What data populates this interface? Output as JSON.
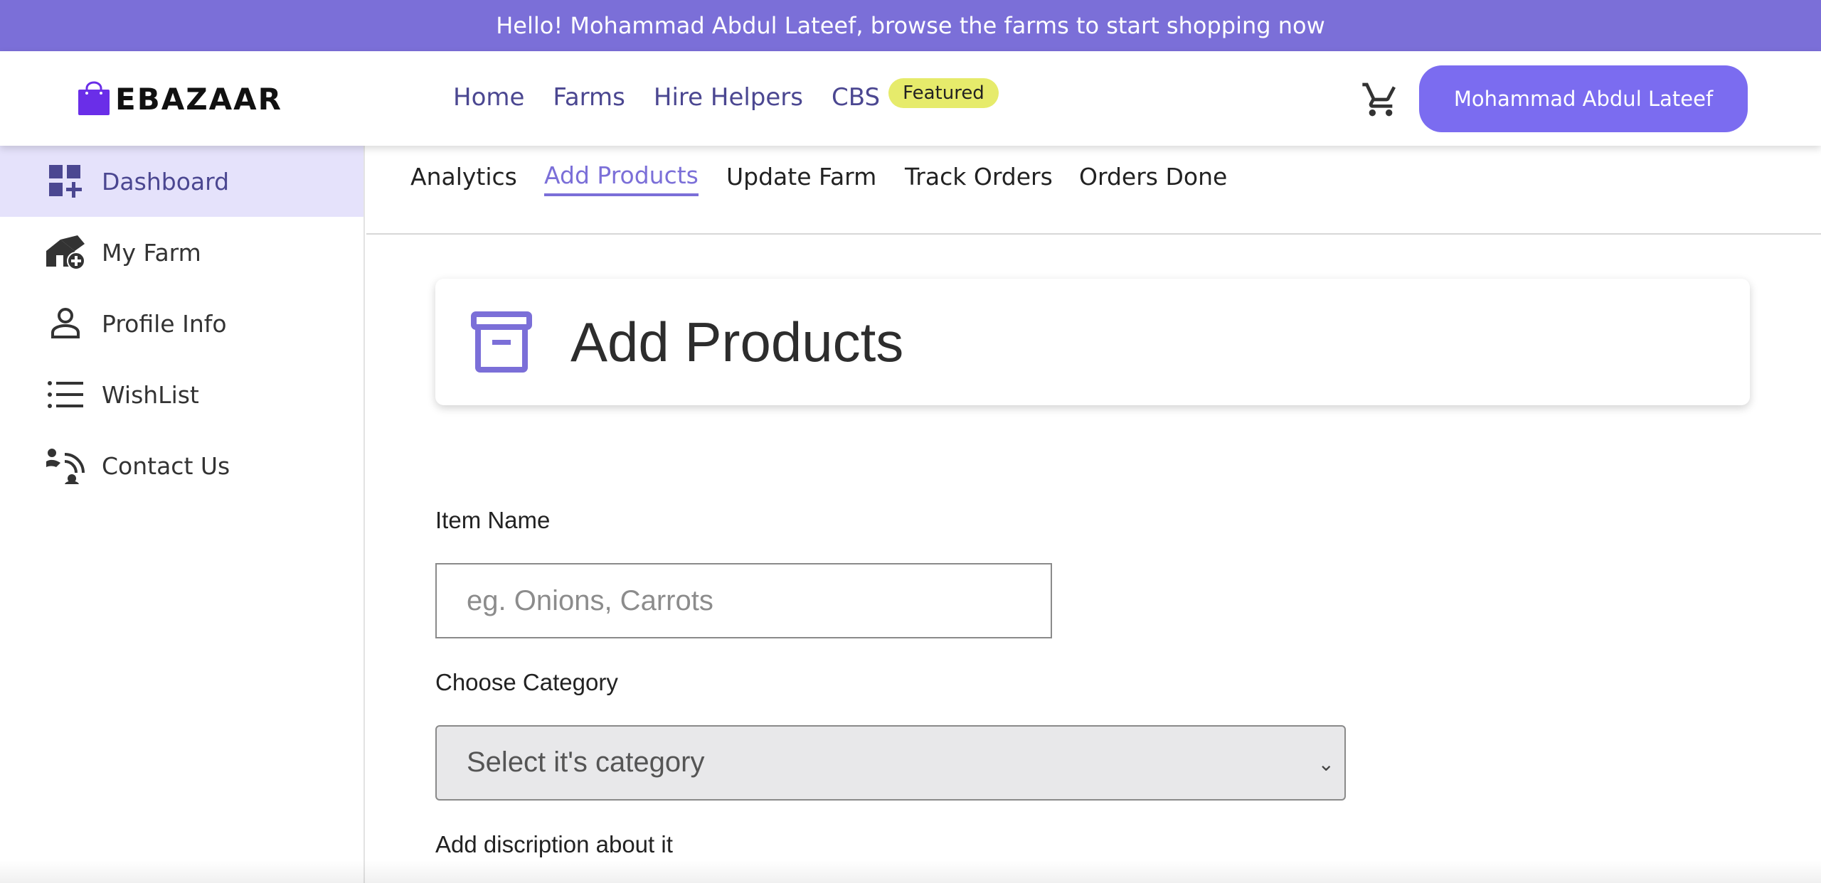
{
  "banner": {
    "text": "Hello! Mohammad Abdul Lateef, browse the farms to start shopping now"
  },
  "header": {
    "logo_text": "EBAZAAR",
    "nav": [
      {
        "label": "Home"
      },
      {
        "label": "Farms"
      },
      {
        "label": "Hire Helpers"
      },
      {
        "label": "CBS"
      }
    ],
    "badge": "Featured",
    "cart_icon": "cart-icon",
    "user_button": "Mohammad Abdul Lateef"
  },
  "sidebar": {
    "items": [
      {
        "label": "Dashboard",
        "icon": "dashboard-add-icon",
        "active": true
      },
      {
        "label": "My Farm",
        "icon": "farm-add-icon"
      },
      {
        "label": "Profile Info",
        "icon": "person-icon"
      },
      {
        "label": "WishList",
        "icon": "list-icon"
      },
      {
        "label": "Contact Us",
        "icon": "contact-wave-icon"
      }
    ]
  },
  "tabs": [
    {
      "label": "Analytics"
    },
    {
      "label": "Add Products",
      "active": true
    },
    {
      "label": "Update Farm"
    },
    {
      "label": "Track Orders"
    },
    {
      "label": "Orders Done"
    }
  ],
  "main": {
    "title": "Add Products",
    "title_icon": "archive-icon",
    "item_name_label": "Item Name",
    "item_name_placeholder": "eg. Onions, Carrots",
    "category_label": "Choose Category",
    "category_selected": "Select it's category",
    "description_label": "Add discription about it"
  },
  "colors": {
    "accent": "#7b6fd8",
    "nav_text": "#4b4791",
    "user_button": "#7b6cf0",
    "badge": "#e6eb6b",
    "active_sidebar_bg": "#e5e2fb"
  }
}
